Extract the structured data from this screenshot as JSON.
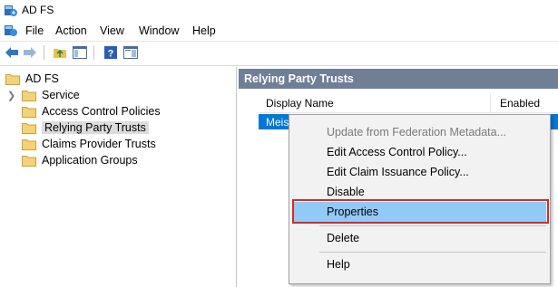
{
  "window": {
    "title": "AD FS"
  },
  "menu": [
    {
      "label": "File"
    },
    {
      "label": "Action"
    },
    {
      "label": "View"
    },
    {
      "label": "Window"
    },
    {
      "label": "Help"
    }
  ],
  "toolbar": {
    "buttons": [
      "back-arrow-icon",
      "forward-arrow-icon",
      "up-folder-icon",
      "show-hide-tree-icon",
      "help-icon",
      "properties-pane-icon"
    ]
  },
  "tree": {
    "root": "AD FS",
    "items": [
      {
        "label": "Service",
        "expandable": true
      },
      {
        "label": "Access Control Policies"
      },
      {
        "label": "Relying Party Trusts",
        "selected": true
      },
      {
        "label": "Claims Provider Trusts"
      },
      {
        "label": "Application Groups"
      }
    ]
  },
  "main": {
    "header": "Relying Party Trusts",
    "columns": [
      "Display Name",
      "Enabled"
    ],
    "rows": [
      {
        "display_name": "Meister"
      }
    ]
  },
  "context_menu": {
    "items": [
      {
        "label": "Update from Federation Metadata...",
        "disabled": true
      },
      {
        "label": "Edit Access Control Policy..."
      },
      {
        "label": "Edit Claim Issuance Policy..."
      },
      {
        "label": "Disable"
      },
      {
        "label": "Properties",
        "highlighted": true
      },
      {
        "label": "Delete"
      },
      {
        "label": "Help"
      }
    ]
  },
  "colors": {
    "selection_blue": "#0078d7",
    "pane_header": "#6f7f96",
    "menu_highlight": "#91c9f7",
    "annotation_red": "#d42a2a",
    "folder_yellow": "#f3d27a"
  }
}
